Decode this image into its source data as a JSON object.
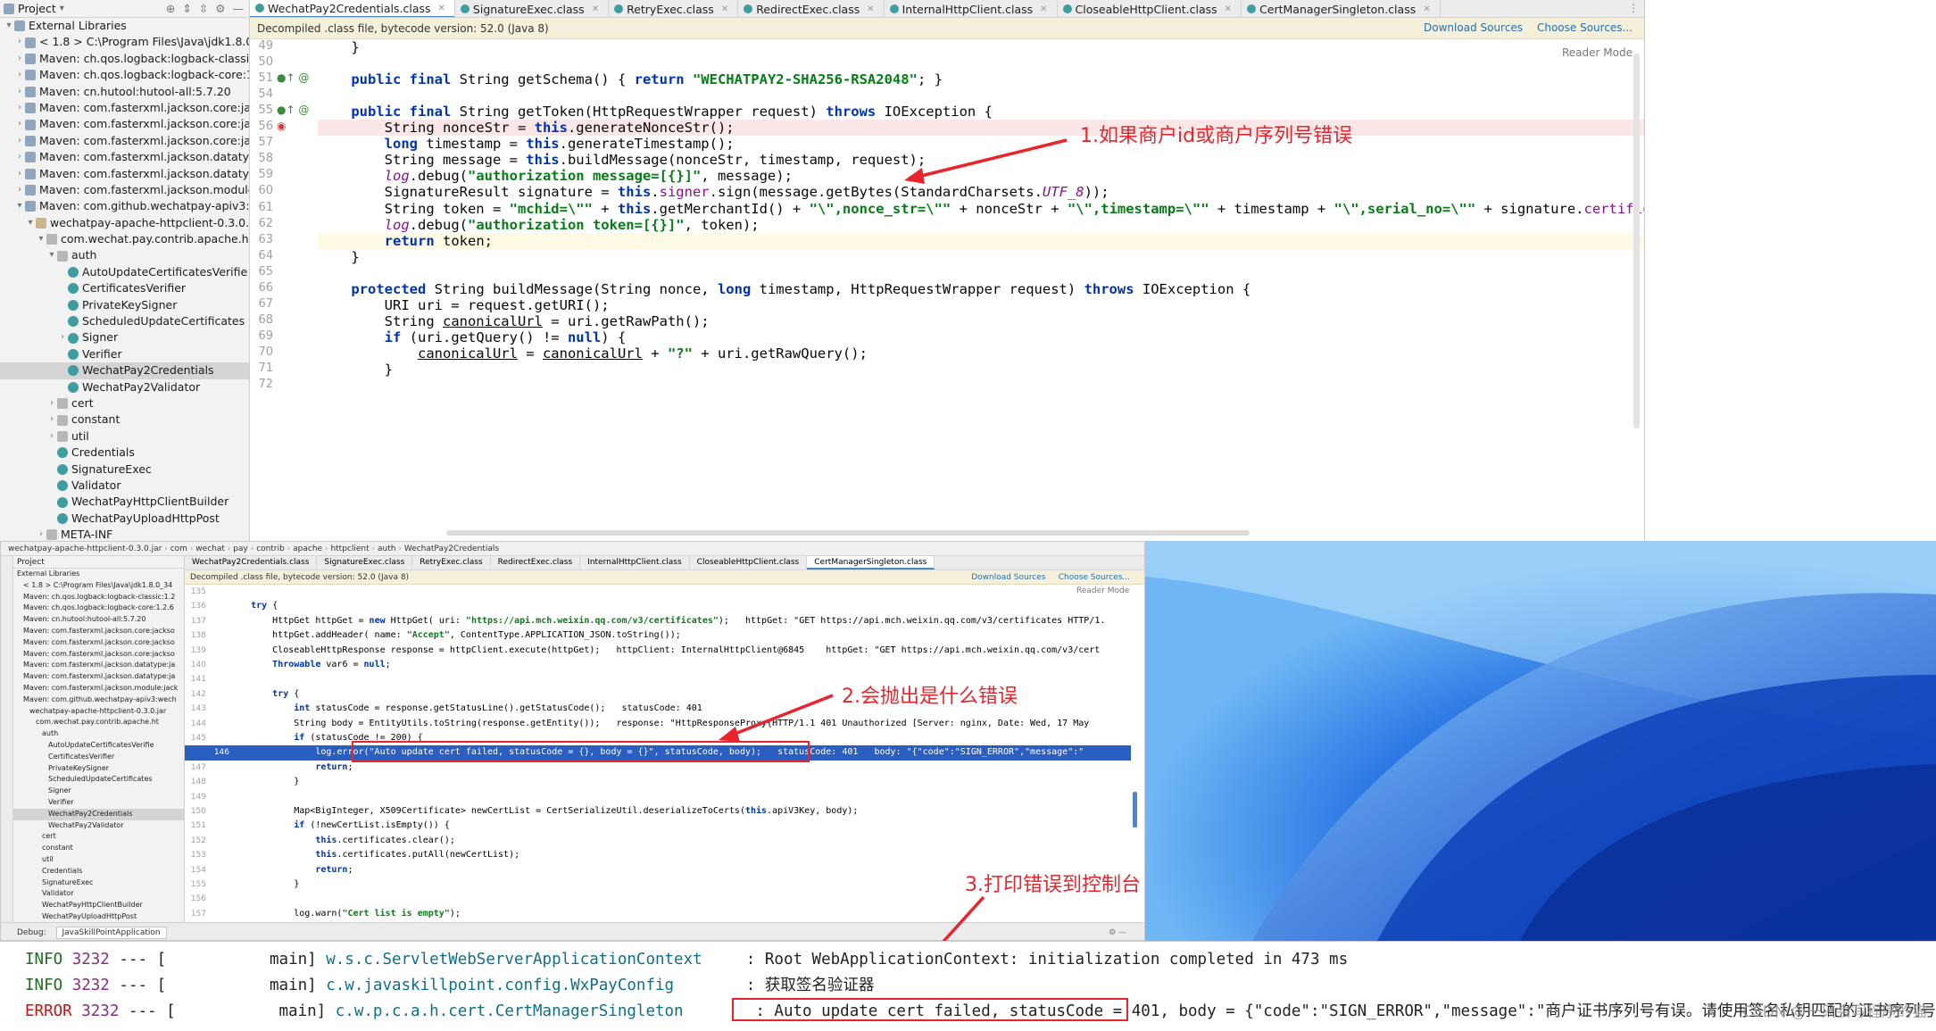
{
  "top_ide": {
    "tree": {
      "header": "Project",
      "rows": [
        {
          "text": "External Libraries",
          "indent": 0,
          "icon": "lib",
          "arrow": "▾"
        },
        {
          "text": "< 1.8 >  C:\\Program Files\\Java\\jdk1.8.0_34",
          "indent": 1,
          "icon": "lib",
          "arrow": "›"
        },
        {
          "text": "Maven: ch.qos.logback:logback-classic:1.2",
          "indent": 1,
          "icon": "lib",
          "arrow": "›"
        },
        {
          "text": "Maven: ch.qos.logback:logback-core:1.2.6",
          "indent": 1,
          "icon": "lib",
          "arrow": "›"
        },
        {
          "text": "Maven: cn.hutool:hutool-all:5.7.20",
          "indent": 1,
          "icon": "lib",
          "arrow": "›"
        },
        {
          "text": "Maven: com.fasterxml.jackson.core:jackso",
          "indent": 1,
          "icon": "lib",
          "arrow": "›"
        },
        {
          "text": "Maven: com.fasterxml.jackson.core:jackso",
          "indent": 1,
          "icon": "lib",
          "arrow": "›"
        },
        {
          "text": "Maven: com.fasterxml.jackson.core:jackso",
          "indent": 1,
          "icon": "lib",
          "arrow": "›"
        },
        {
          "text": "Maven: com.fasterxml.jackson.datatype:ja",
          "indent": 1,
          "icon": "lib",
          "arrow": "›"
        },
        {
          "text": "Maven: com.fasterxml.jackson.datatype:ja",
          "indent": 1,
          "icon": "lib",
          "arrow": "›"
        },
        {
          "text": "Maven: com.fasterxml.jackson.module:jack",
          "indent": 1,
          "icon": "lib",
          "arrow": "›"
        },
        {
          "text": "Maven: com.github.wechatpay-apiv3:wech",
          "indent": 1,
          "icon": "lib",
          "arrow": "▾"
        },
        {
          "text": "wechatpay-apache-httpclient-0.3.0.jar",
          "indent": 2,
          "icon": "jar",
          "arrow": "▾"
        },
        {
          "text": "com.wechat.pay.contrib.apache.http",
          "indent": 3,
          "icon": "pkg",
          "arrow": "▾"
        },
        {
          "text": "auth",
          "indent": 4,
          "icon": "pkg",
          "arrow": "▾"
        },
        {
          "text": "AutoUpdateCertificatesVerifie",
          "indent": 5,
          "icon": "cls",
          "arrow": ""
        },
        {
          "text": "CertificatesVerifier",
          "indent": 5,
          "icon": "cls",
          "arrow": ""
        },
        {
          "text": "PrivateKeySigner",
          "indent": 5,
          "icon": "cls",
          "arrow": ""
        },
        {
          "text": "ScheduledUpdateCertificates",
          "indent": 5,
          "icon": "cls",
          "arrow": ""
        },
        {
          "text": "Signer",
          "indent": 5,
          "icon": "cls",
          "arrow": "›"
        },
        {
          "text": "Verifier",
          "indent": 5,
          "icon": "cls",
          "arrow": ""
        },
        {
          "text": "WechatPay2Credentials",
          "indent": 5,
          "icon": "cls",
          "arrow": "",
          "selected": true
        },
        {
          "text": "WechatPay2Validator",
          "indent": 5,
          "icon": "cls",
          "arrow": ""
        },
        {
          "text": "cert",
          "indent": 4,
          "icon": "pkg",
          "arrow": "›"
        },
        {
          "text": "constant",
          "indent": 4,
          "icon": "pkg",
          "arrow": "›"
        },
        {
          "text": "util",
          "indent": 4,
          "icon": "pkg",
          "arrow": "›"
        },
        {
          "text": "Credentials",
          "indent": 4,
          "icon": "cls",
          "arrow": ""
        },
        {
          "text": "SignatureExec",
          "indent": 4,
          "icon": "cls",
          "arrow": ""
        },
        {
          "text": "Validator",
          "indent": 4,
          "icon": "cls",
          "arrow": ""
        },
        {
          "text": "WechatPayHttpClientBuilder",
          "indent": 4,
          "icon": "cls",
          "arrow": ""
        },
        {
          "text": "WechatPayUploadHttpPost",
          "indent": 4,
          "icon": "cls",
          "arrow": ""
        },
        {
          "text": "META-INF",
          "indent": 3,
          "icon": "pkg",
          "arrow": "›"
        }
      ]
    },
    "tabs": [
      {
        "label": "WechatPay2Credentials.class",
        "active": true
      },
      {
        "label": "SignatureExec.class",
        "active": false
      },
      {
        "label": "RetryExec.class",
        "active": false
      },
      {
        "label": "RedirectExec.class",
        "active": false
      },
      {
        "label": "InternalHttpClient.class",
        "active": false
      },
      {
        "label": "CloseableHttpClient.class",
        "active": false
      },
      {
        "label": "CertManagerSingleton.class",
        "active": false
      }
    ],
    "banner": {
      "text": "Decompiled .class file, bytecode version: 52.0 (Java 8)",
      "download_sources": "Download Sources",
      "choose_sources": "Choose Sources...",
      "reader_mode": "Reader Mode"
    },
    "line_numbers": [
      "49",
      "50",
      "51",
      "54",
      "55",
      "56",
      "57",
      "58",
      "59",
      "60",
      "61",
      "62",
      "63",
      "64",
      "65",
      "66",
      "67",
      "68",
      "69",
      "70",
      "71",
      "72"
    ],
    "code_lines": [
      "    }",
      "",
      "    <k>public final</k> String getSchema() { <k>return</k> <s>\"WECHATPAY2-SHA256-RSA2048\"</s>; }",
      "",
      "    <k>public final</k> String getToken(HttpRequestWrapper request) <k>throws</k> IOException {",
      "        String nonceStr = <k>this</k>.generateNonceStr();",
      "        <k>long</k> timestamp = <k>this</k>.generateTimestamp();",
      "        String message = <k>this</k>.buildMessage(nonceStr, timestamp, request);",
      "        <i>log</i>.debug(<s>\"authorization message=[{}]\"</s>, message);",
      "        SignatureResult signature = <k>this</k>.<f>signer</f>.sign(message.getBytes(StandardCharsets.<i>UTF_8</i>));",
      "        String token = <s>\"mchid=\\\"\"</s> + <k>this</k>.getMerchantId() + <s>\"\\\",nonce_str=\\\"\"</s> + nonceStr + <s>\"\\\",timestamp=\\\"\"</s> + timestamp + <s>\"\\\",serial_no=\\\"\"</s> + signature.<f>certificateSeria</f>",
      "        <i>log</i>.debug(<s>\"authorization token=[{}]\"</s>, token);",
      "        <k>return</k> token;",
      "    }",
      "",
      "    <k>protected</k> String buildMessage(String nonce, <k>long</k> timestamp, HttpRequestWrapper request) <k>throws</k> IOException {",
      "        URI uri = request.getURI();",
      "        String <u>canonicalUrl</u> = uri.getRawPath();",
      "        <k>if</k> (uri.getQuery() != <k>null</k>) {",
      "            <u>canonicalUrl</u> = <u>canonicalUrl</u> + <s>\"?\"</s> + uri.getRawQuery();",
      "        }",
      ""
    ],
    "annotation": "1.如果商户id或商户序列号错误"
  },
  "bottom_ide": {
    "breadcrumb": [
      "wechatpay-apache-httpclient-0.3.0.jar",
      "com",
      "wechat",
      "pay",
      "contrib",
      "apache",
      "httpclient",
      "auth",
      "WechatPay2Credentials"
    ],
    "tabs": [
      "WechatPay2Credentials.class",
      "SignatureExec.class",
      "RetryExec.class",
      "RedirectExec.class",
      "InternalHttpClient.class",
      "CloseableHttpClient.class",
      "CertManagerSingleton.class"
    ],
    "banner": "Decompiled .class file, bytecode version: 52.0 (Java 8)",
    "download_sources": "Download Sources",
    "choose_sources": "Choose Sources...",
    "reader_mode": "Reader Mode",
    "tree_header": "Project",
    "tree_rows": [
      "External Libraries",
      "< 1.8 > C:\\Program Files\\Java\\jdk1.8.0_34",
      "Maven: ch.qos.logback:logback-classic:1.2",
      "Maven: ch.qos.logback:logback-core:1.2.6",
      "Maven: cn.hutool:hutool-all:5.7.20",
      "Maven: com.fasterxml.jackson.core:jackso",
      "Maven: com.fasterxml.jackson.core:jackso",
      "Maven: com.fasterxml.jackson.core:jackso",
      "Maven: com.fasterxml.jackson.datatype:ja",
      "Maven: com.fasterxml.jackson.datatype:ja",
      "Maven: com.fasterxml.jackson.module:jack",
      "Maven: com.github.wechatpay-apiv3:wech",
      "wechatpay-apache-httpclient-0.3.0.jar",
      "com.wechat.pay.contrib.apache.ht",
      "auth",
      "AutoUpdateCertificatesVerifie",
      "CertificatesVerifier",
      "PrivateKeySigner",
      "ScheduledUpdateCertificates",
      "Signer",
      "Verifier",
      "WechatPay2Credentials",
      "WechatPay2Validator",
      "cert",
      "constant",
      "util",
      "Credentials",
      "SignatureExec",
      "Validator",
      "WechatPayHttpClientBuilder",
      "WechatPayUploadHttpPost",
      "META-INF"
    ],
    "line_numbers": [
      "135",
      "136",
      "137",
      "138",
      "139",
      "140",
      "141",
      "142",
      "143",
      "144",
      "145",
      "146",
      "147",
      "148",
      "149",
      "150",
      "151",
      "152",
      "153",
      "154",
      "155",
      "156",
      "157"
    ],
    "code_lines": [
      "",
      "    try {",
      "        HttpGet httpGet = new HttpGet( uri: \"https://api.mch.weixin.qq.com/v3/certificates\");   httpGet: \"GET https://api.mch.weixin.qq.com/v3/certificates HTTP/1.",
      "        httpGet.addHeader( name: \"Accept\", ContentType.APPLICATION_JSON.toString());",
      "        CloseableHttpResponse response = httpClient.execute(httpGet);   httpClient: InternalHttpClient@6845    httpGet: \"GET https://api.mch.weixin.qq.com/v3/cert",
      "        Throwable var6 = null;",
      "",
      "        try {",
      "            int statusCode = response.getStatusLine().getStatusCode();   statusCode: 401",
      "            String body = EntityUtils.toString(response.getEntity());   response: \"HttpResponseProxy{HTTP/1.1 401 Unauthorized [Server: nginx, Date: Wed, 17 May",
      "            if (statusCode != 200) {",
      "                log.error(\"Auto update cert failed, statusCode = {}, body = {}\", statusCode, body);   statusCode: 401   body: \"{\"code\":\"SIGN_ERROR\",\"message\":\"",
      "                return;",
      "            }",
      "",
      "            Map<BigInteger, X509Certificate> newCertList = CertSerializeUtil.deserializeToCerts(this.apiV3Key, body);",
      "            if (!newCertList.isEmpty()) {",
      "                this.certificates.clear();",
      "                this.certificates.putAll(newCertList);",
      "                return;",
      "            }",
      "",
      "            log.warn(\"Cert list is empty\");"
    ],
    "annotation2": "2.会抛出是什么错误",
    "annotation3": "3.打印错误到控制台",
    "debug_label": "Debug:",
    "debug_tab": "JavaSkillPointApplication"
  },
  "console": {
    "rows": [
      {
        "level": "INFO",
        "pid": "3232",
        "sep": "---",
        "thread": "[           main]",
        "logger": "w.s.c.ServletWebServerApplicationContext",
        "colon": ":",
        "message": "Root WebApplicationContext: initialization completed in 473 ms"
      },
      {
        "level": "INFO",
        "pid": "3232",
        "sep": "---",
        "thread": "[           main]",
        "logger": "c.w.javaskillpoint.config.WxPayConfig",
        "colon": ":",
        "message": "获取签名验证器"
      },
      {
        "level": "ERROR",
        "pid": "3232",
        "sep": "---",
        "thread": "[           main]",
        "logger": "c.w.p.c.a.h.cert.CertManagerSingleton",
        "colon": ":",
        "message_boxed": "Auto update cert failed, statusCode = 401,",
        "message_rest": " body = {\"code\":\"SIGN_ERROR\",\"message\":\"商户证书序列号有误。请使用签名私钥匹配的证书序列号"
      }
    ],
    "watermark": "CSDN @一只会写程序的猫"
  },
  "colors": {
    "accent_red": "#e8252c",
    "keyword": "#0033b3",
    "string": "#067d17",
    "selection_blue": "#2a5ec0",
    "desktop_blue": "#1463d8"
  }
}
